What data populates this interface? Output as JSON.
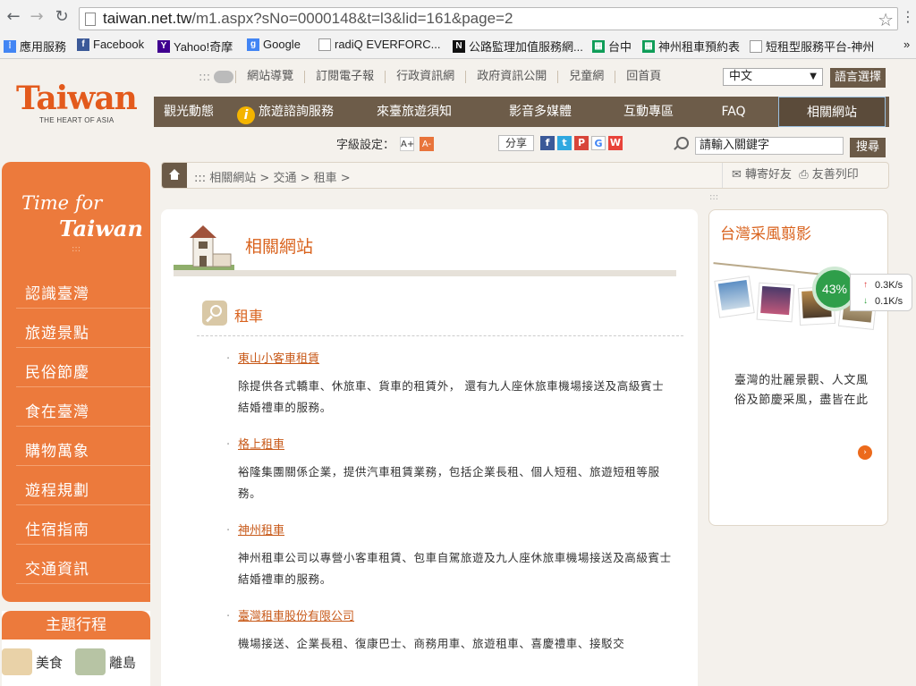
{
  "browser": {
    "url_host": "taiwan.net.tw",
    "url_path": "/m1.aspx?sNo=0000148&t=l3&lid=161&page=2",
    "bookmarks": [
      {
        "label": "應用服務",
        "icon": "apps-grid-icon",
        "color": "#4285f4"
      },
      {
        "label": "Facebook",
        "icon": "facebook-icon",
        "color": "#3b5998"
      },
      {
        "label": "Yahoo!奇摩",
        "icon": "yahoo-icon",
        "color": "#400090"
      },
      {
        "label": "Google",
        "icon": "google-icon",
        "color": "#4285f4"
      },
      {
        "label": "radiQ EVERFORC...",
        "icon": "page-icon",
        "color": "#999999"
      },
      {
        "label": "公路監理加值服務網...",
        "icon": "n-logo-icon",
        "color": "#111111"
      },
      {
        "label": "台中",
        "icon": "sheet-icon",
        "color": "#0f9d58"
      },
      {
        "label": "神州租車預約表",
        "icon": "sheet-icon",
        "color": "#0f9d58"
      },
      {
        "label": "短租型服務平台-神州",
        "icon": "page-icon",
        "color": "#999999"
      }
    ]
  },
  "header": {
    "logo": "Taiwan",
    "logo_tagline": "THE HEART OF ASIA",
    "toplinks_prefix": ":::",
    "toplinks": [
      "網站導覽",
      "訂閱電子報",
      "行政資訊網",
      "政府資訊公開",
      "兒童網",
      "回首頁"
    ],
    "language": "中文",
    "language_button": "語言選擇",
    "nav": [
      "觀光動態",
      "旅遊諮詢服務",
      "來臺旅遊須知",
      "影音多媒體",
      "互動專區",
      "FAQ",
      "相關網站"
    ],
    "font_size_label": "字級設定：",
    "font_small": "A+",
    "font_large": "A-",
    "share_label": "分享",
    "search_placeholder": "請輸入關鍵字",
    "search_button": "搜尋"
  },
  "sidebar": {
    "slogan_line1": "Time for",
    "slogan_line2": "Taiwan",
    "dots": ":::",
    "items": [
      "認識臺灣",
      "旅遊景點",
      "民俗節慶",
      "食在臺灣",
      "購物萬象",
      "遊程規劃",
      "住宿指南",
      "交通資訊"
    ],
    "theme_title": "主題行程",
    "theme_items": [
      "美食",
      "離島"
    ]
  },
  "breadcrumb": {
    "prefix": ":::",
    "items": [
      "相關網站",
      "交通",
      "租車"
    ],
    "forward": "轉寄好友",
    "print": "友善列印"
  },
  "content": {
    "title": "相關網站",
    "category": "租車",
    "entries": [
      {
        "title": "東山小客車租賃",
        "desc": "除提供各式轎車、休旅車、貨車的租賃外， 還有九人座休旅車機場接送及高級賓士結婚禮車的服務。"
      },
      {
        "title": "格上租車",
        "desc": "裕隆集團關係企業，提供汽車租賃業務，包括企業長租、個人短租、旅遊短租等服務。"
      },
      {
        "title": "神州租車",
        "desc": "神州租車公司以專營小客車租賃、包車自駕旅遊及九人座休旅車機場接送及高級賓士結婚禮車的服務。"
      },
      {
        "title": "臺灣租車股份有限公司",
        "desc": "機場接送、企業長租、復康巴士、商務用車、旅遊租車、喜慶禮車、接駁交"
      }
    ]
  },
  "widget": {
    "dots": ":::",
    "title": "台灣采風翦影",
    "text": "臺灣的壯麗景觀、人文風俗及節慶采風，盡皆在此",
    "more": "›"
  },
  "net_monitor": {
    "percent": "43%",
    "up_rate": "0.3K/s",
    "down_rate": "0.1K/s"
  },
  "colors": {
    "brand_orange": "#ec7a3c",
    "nav_brown": "#6d5c49",
    "link_orange": "#c85a1a"
  }
}
